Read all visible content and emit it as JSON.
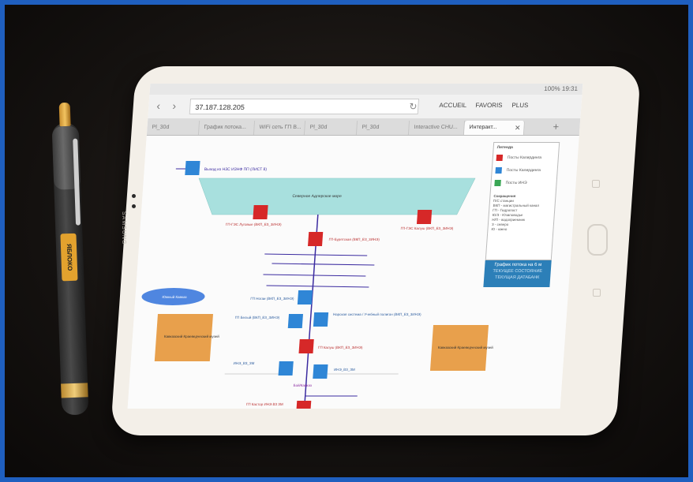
{
  "browser": {
    "status": "100% 19:31",
    "url": "37.187.128.205",
    "menu": [
      "ACCUEIL",
      "FAVORIS",
      "PLUS"
    ],
    "tabs": [
      "Pl_30d",
      "График потока...",
      "WiFi сеть ГП В...",
      "Pl_30d",
      "Pl_30d",
      "Interactive CHU...",
      "Интеракт..."
    ],
    "tab_close": "✕",
    "tab_add": "+"
  },
  "device": {
    "brand": "SAMSUNG"
  },
  "pen": {
    "label": "ЯБЛОКО"
  },
  "diagram": {
    "header_label": "Выход из НЗС ИЗНФ ПП (ЛИСТ 8)",
    "pool_label": "Северное Адлерское море",
    "left_station": "ГП-ГЭС Луговые (ВКП_ЕЗ_3ИНЭ)",
    "right_station": "ГП-ГЭС Калуш (ВКП_ЕЗ_3ИНЭ)",
    "center_top_station": "ГП-Бурятская (ВКП_ЕЗ_3ИНЭ)",
    "middle_blue_station": "ГП Ногаи (ВКП_ЕЗ_3ИНЭ)",
    "left_lower_station": "ГП Белый (ВКП_ЕЗ_3ИНЭ)",
    "right_lower_station": "Нарская система / Учебный полигон (ВКП_ЕЗ_3ИНЭ)",
    "red_lower_station": "ГП Калуш (ВКП_ЕЗ_3ИНЭ)",
    "left_pair": "ИНЭ_ВЗ_ЗМ",
    "right_pair": "ИНЭ_ВЗ_ЗМ",
    "bottom_label": "Бой/Кавказ",
    "bottom_station": "ГП Кастор ИНЭ ВЗ ЗМ",
    "ellipse_label": "Южный Кавказ",
    "left_block": "Кавказский Краеведческий музей",
    "right_block": "Кавказский Краеведческий музей",
    "legend_title": "Легенда",
    "legend_items": [
      "Посты Калирдинга",
      "Посты Калирдинга",
      "Посты ИНЭ"
    ],
    "legend_colors": [
      "#d62828",
      "#2f86d6",
      "#3aa655"
    ],
    "legend_abbrev": [
      "Сокращения",
      "П/С станции",
      "ВКП - магистральный канал",
      "ГП - Гидропост",
      "Ю/З - Юзаповодье",
      "Н/П - водоприемник",
      "З - северо",
      "Ю - южно"
    ],
    "button_text": "График потока на 6 м",
    "button_sub": "ТЕКУЩЕЕ СОСТОЯНИЕ ТЕКУЩАЯ ДАТАБАНК"
  },
  "colors": {
    "red_post": "#d62828",
    "blue_post": "#2f86d6",
    "pool": "#a8e0de",
    "orange_block": "#e8a04c",
    "ellipse": "#4f86e0",
    "line": "#3b2ba0"
  }
}
